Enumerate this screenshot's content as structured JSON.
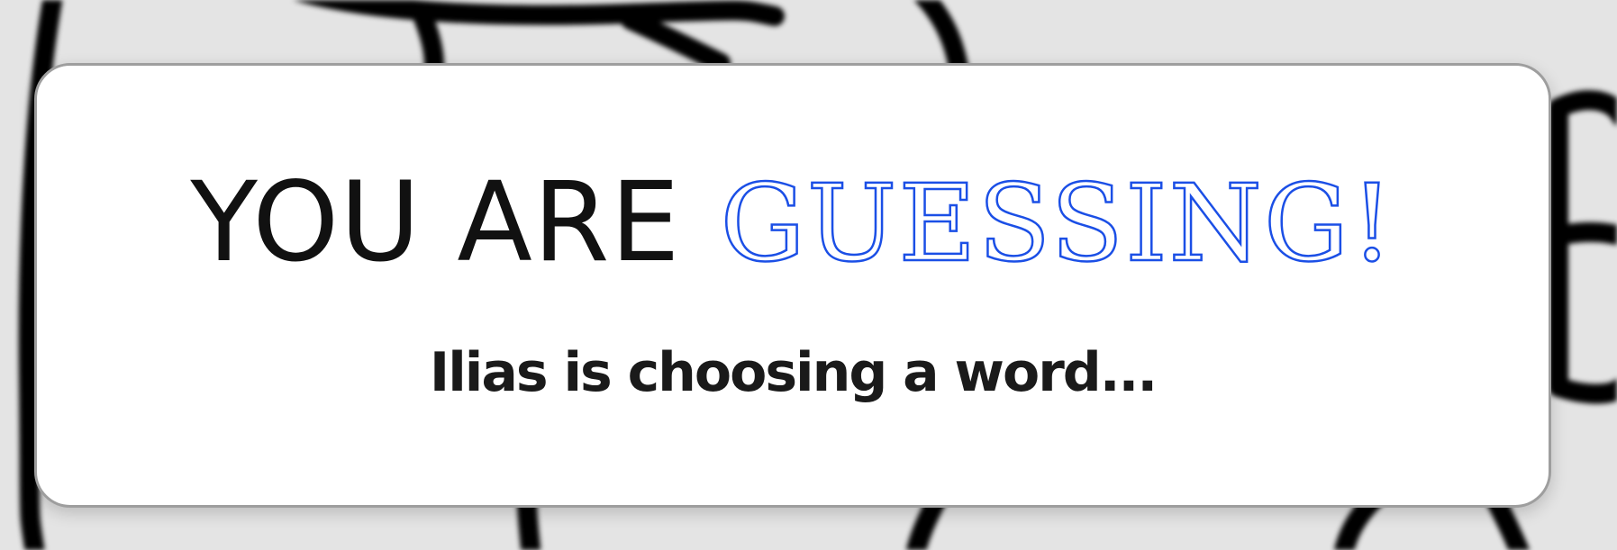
{
  "colors": {
    "background": "#e4e4e4",
    "modal_background": "#ffffff",
    "modal_border": "#9e9e9e",
    "prefix_text": "#111111",
    "accent": "#1b4fe6",
    "status_text": "#1a1a1a"
  },
  "overlay": {
    "headline_prefix": "YOU ARE",
    "headline_role": "GUESSING!",
    "status_message": "Ilias is choosing a word..."
  }
}
